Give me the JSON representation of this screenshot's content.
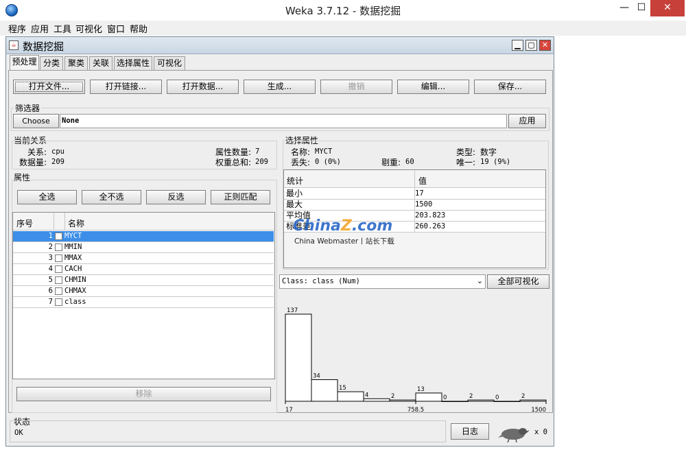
{
  "window": {
    "title": "Weka 3.7.12 - 数据挖掘",
    "minimize": "—",
    "maximize": "☐",
    "close": "✕"
  },
  "menu": [
    "程序",
    "应用",
    "工具",
    "可视化",
    "窗口",
    "帮助"
  ],
  "frame": {
    "title": "数据挖掘"
  },
  "tabs": [
    "预处理",
    "分类",
    "聚类",
    "关联",
    "选择属性",
    "可视化"
  ],
  "toolbar": {
    "open_file": "打开文件...",
    "open_url": "打开链接...",
    "open_db": "打开数据...",
    "generate": "生成...",
    "undo": "撤销",
    "edit": "编辑...",
    "save": "保存..."
  },
  "filter": {
    "title": "筛选器",
    "choose": "Choose",
    "value": "None",
    "apply": "应用"
  },
  "relation": {
    "title": "当前关系",
    "name_label": "关系:",
    "name": "cpu",
    "instances_label": "数据量:",
    "instances": "209",
    "attributes_label": "属性数量:",
    "attributes": "7",
    "weights_label": "权重总和:",
    "weights": "209"
  },
  "attributes_panel": {
    "title": "属性",
    "all": "全选",
    "none": "全不选",
    "invert": "反选",
    "pattern": "正则匹配",
    "col_no": "序号",
    "col_name": "名称",
    "rows": [
      {
        "no": "1",
        "name": "MYCT"
      },
      {
        "no": "2",
        "name": "MMIN"
      },
      {
        "no": "3",
        "name": "MMAX"
      },
      {
        "no": "4",
        "name": "CACH"
      },
      {
        "no": "5",
        "name": "CHMIN"
      },
      {
        "no": "6",
        "name": "CHMAX"
      },
      {
        "no": "7",
        "name": "class"
      }
    ],
    "remove": "移除"
  },
  "selected": {
    "title": "选择属性",
    "name_label": "名称:",
    "name": "MYCT",
    "type_label": "类型:",
    "type": "数字",
    "missing_label": "丢失:",
    "missing": "0 (0%)",
    "distinct_label": "剔重:",
    "distinct": "60",
    "unique_label": "唯一:",
    "unique": "19 (9%)",
    "col_stat": "统计",
    "col_value": "值",
    "stats": [
      {
        "name": "最小",
        "value": "17"
      },
      {
        "name": "最大",
        "value": "1500"
      },
      {
        "name": "平均值",
        "value": "203.823"
      },
      {
        "name": "标准差",
        "value": "260.263"
      }
    ]
  },
  "watermark": {
    "brand": "China",
    "brand_z": "Z",
    "brand_tld": ".com",
    "sub": "China Webmaster丨站长下载"
  },
  "class_select": {
    "value": "Class: class (Num)",
    "visualize_all": "全部可视化"
  },
  "status": {
    "title": "状态",
    "text": "OK",
    "log": "日志",
    "count": "x 0"
  },
  "chart_data": {
    "type": "bar",
    "values": [
      137,
      34,
      15,
      4,
      2,
      13,
      0,
      2,
      0,
      2
    ],
    "x_ticks": [
      "17",
      "758.5",
      "1500"
    ],
    "ylim": [
      0,
      137
    ],
    "colors": {
      "bar_fill": "#ffffff",
      "bar_stroke": "#000000"
    }
  }
}
